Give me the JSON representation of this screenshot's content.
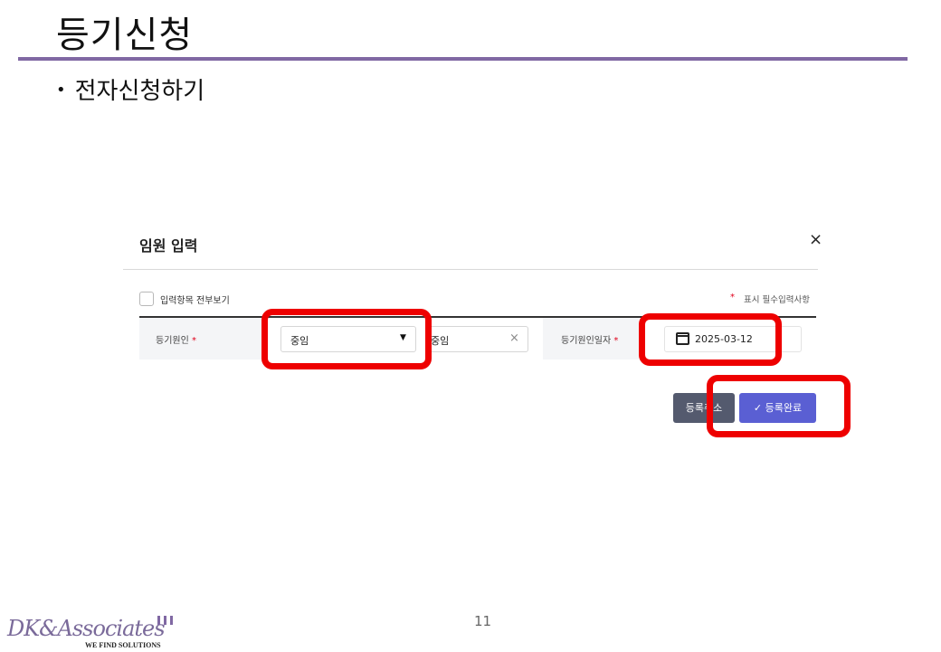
{
  "slide": {
    "title": "등기신청",
    "bullet": "전자신청하기",
    "page_number": "11"
  },
  "modal": {
    "title": "임원 입력",
    "close_glyph": "×",
    "checkbox_label": "입력항목 전부보기",
    "required_star": "*",
    "required_note": "표시 필수입력사항",
    "form": {
      "cause_label": "등기원인",
      "cause_select_value": "중임",
      "cause_select_options": [
        "중임"
      ],
      "cause_text_value": "중임",
      "clear_glyph": "×",
      "date_label": "등기원인일자",
      "date_value": "2025-03-12"
    },
    "buttons": {
      "cancel_label": "등록취소",
      "confirm_label": "✓ 등록완료"
    }
  },
  "highlights": {
    "color": "#ee0000"
  },
  "logo": {
    "name": "DK&Associates",
    "tagline": "WE FIND SOLUTIONS"
  },
  "colors": {
    "title_rule": "#8068a3",
    "confirm_button": "#5a5fd3",
    "cancel_button": "#545a6e",
    "required": "#e0001b"
  }
}
